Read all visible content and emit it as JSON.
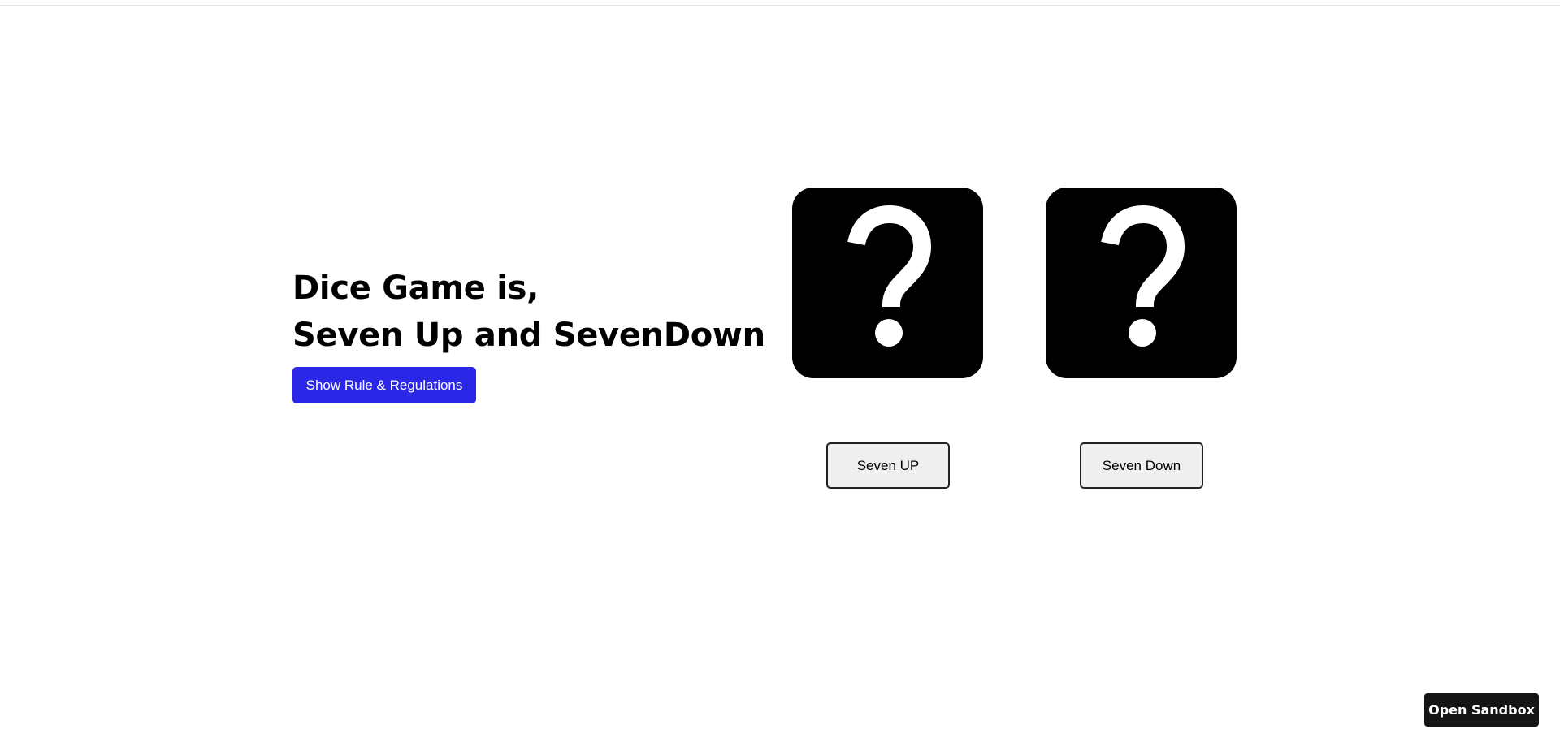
{
  "intro": {
    "title_line1": "Dice Game is,",
    "title_line2": "Seven Up and SevenDown",
    "rules_button_label": "Show Rule & Regulations"
  },
  "dice": [
    {
      "face_icon": "question-mark-icon",
      "bet_label": "Seven UP"
    },
    {
      "face_icon": "question-mark-icon",
      "bet_label": "Seven Down"
    }
  ],
  "sandbox": {
    "label": "Open Sandbox"
  },
  "colors": {
    "accent": "#2b27e6",
    "die_background": "#000000",
    "die_glyph": "#ffffff"
  }
}
